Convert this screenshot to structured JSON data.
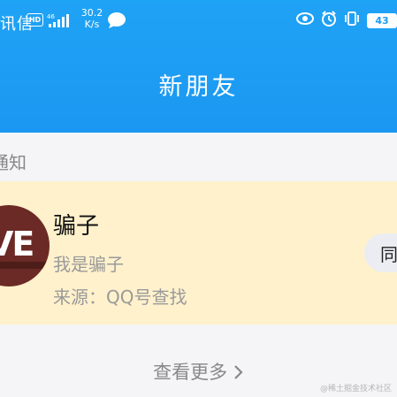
{
  "status_bar": {
    "carrier": "讯信",
    "hd": "HD",
    "network": "46",
    "speed_value": "30.2",
    "speed_unit": "K/s",
    "battery": "43"
  },
  "header": {
    "title": "新朋友"
  },
  "section": {
    "label": "通知"
  },
  "notification": {
    "avatar_text": "VE",
    "name": "骗子",
    "message": "我是骗子",
    "source": "来源：QQ号查找",
    "action_label": "同"
  },
  "footer": {
    "view_more": "查看更多",
    "watermark": "@稀土掘金技术社区"
  },
  "colors": {
    "header_blue": "#1d9cf3",
    "card_bg": "#fef1cc"
  }
}
